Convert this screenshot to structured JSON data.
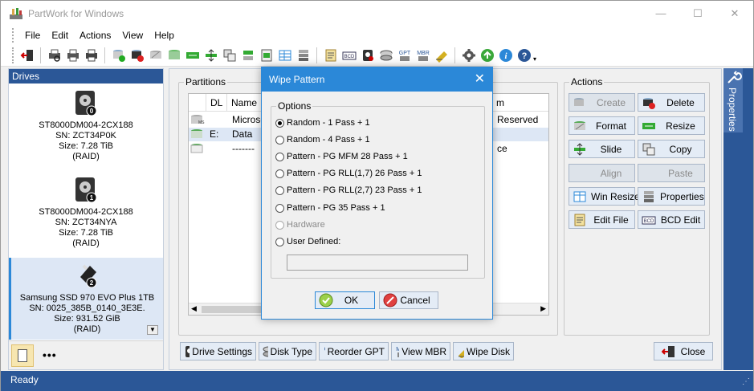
{
  "app": {
    "title": "PartWork for Windows"
  },
  "menu": [
    "File",
    "Edit",
    "Actions",
    "View",
    "Help"
  ],
  "drives": {
    "header": "Drives",
    "items": [
      {
        "model": "ST8000DM004-2CX188",
        "sn": "SN: ZCT34P0K",
        "size": "Size: 7.28 TiB",
        "type": "(RAID)",
        "index": "0"
      },
      {
        "model": "ST8000DM004-2CX188",
        "sn": "SN: ZCT34NYA",
        "size": "Size: 7.28 TiB",
        "type": "(RAID)",
        "index": "1"
      },
      {
        "model": "Samsung SSD 970 EVO Plus 1TB",
        "sn": "SN: 0025_385B_0140_3E3E.",
        "size": "Size: 931.52 GiB",
        "type": "(RAID)",
        "index": "2"
      }
    ],
    "more": "•••"
  },
  "partitions": {
    "label": "Partitions",
    "columns": [
      "DL",
      "Name"
    ],
    "rows": [
      {
        "dl": "",
        "name": "Microso",
        "tail": "Reserved"
      },
      {
        "dl": "E:",
        "name": "Data",
        "tail": ""
      },
      {
        "dl": "",
        "name": "-------",
        "tail": "ce"
      }
    ],
    "col_tail_header": "m"
  },
  "actions": {
    "label": "Actions",
    "buttons": [
      {
        "label": "Create",
        "enabled": false
      },
      {
        "label": "Delete",
        "enabled": true
      },
      {
        "label": "Format",
        "enabled": true
      },
      {
        "label": "Resize",
        "enabled": true
      },
      {
        "label": "Slide",
        "enabled": true
      },
      {
        "label": "Copy",
        "enabled": true
      },
      {
        "label": "Align",
        "enabled": false
      },
      {
        "label": "Paste",
        "enabled": false
      },
      {
        "label": "Win Resize",
        "enabled": true
      },
      {
        "label": "Properties",
        "enabled": true
      },
      {
        "label": "Edit File",
        "enabled": true
      },
      {
        "label": "BCD Edit",
        "enabled": true
      }
    ]
  },
  "bottom": {
    "drive_settings": "Drive Settings",
    "disk_type": "Disk Type",
    "reorder_gpt": "Reorder GPT",
    "view_mbr": "View MBR",
    "wipe_disk": "Wipe Disk",
    "close": "Close"
  },
  "sidebar": {
    "properties": "Properties"
  },
  "status": {
    "text": "Ready"
  },
  "dialog": {
    "title": "Wipe Pattern",
    "group": "Options",
    "options": [
      {
        "label": "Random - 1 Pass + 1",
        "selected": true,
        "enabled": true
      },
      {
        "label": "Random - 4 Pass + 1",
        "selected": false,
        "enabled": true
      },
      {
        "label": "Pattern - PG MFM 28 Pass + 1",
        "selected": false,
        "enabled": true
      },
      {
        "label": "Pattern - PG RLL(1,7) 26 Pass + 1",
        "selected": false,
        "enabled": true
      },
      {
        "label": "Pattern - PG RLL(2,7) 23 Pass + 1",
        "selected": false,
        "enabled": true
      },
      {
        "label": "Pattern - PG 35 Pass + 1",
        "selected": false,
        "enabled": true
      },
      {
        "label": "Hardware",
        "selected": false,
        "enabled": false
      },
      {
        "label": "User Defined:",
        "selected": false,
        "enabled": true
      }
    ],
    "user_defined_value": "",
    "ok": "OK",
    "cancel": "Cancel"
  },
  "colors": {
    "accent": "#2b88d8",
    "brand": "#2b5797"
  }
}
